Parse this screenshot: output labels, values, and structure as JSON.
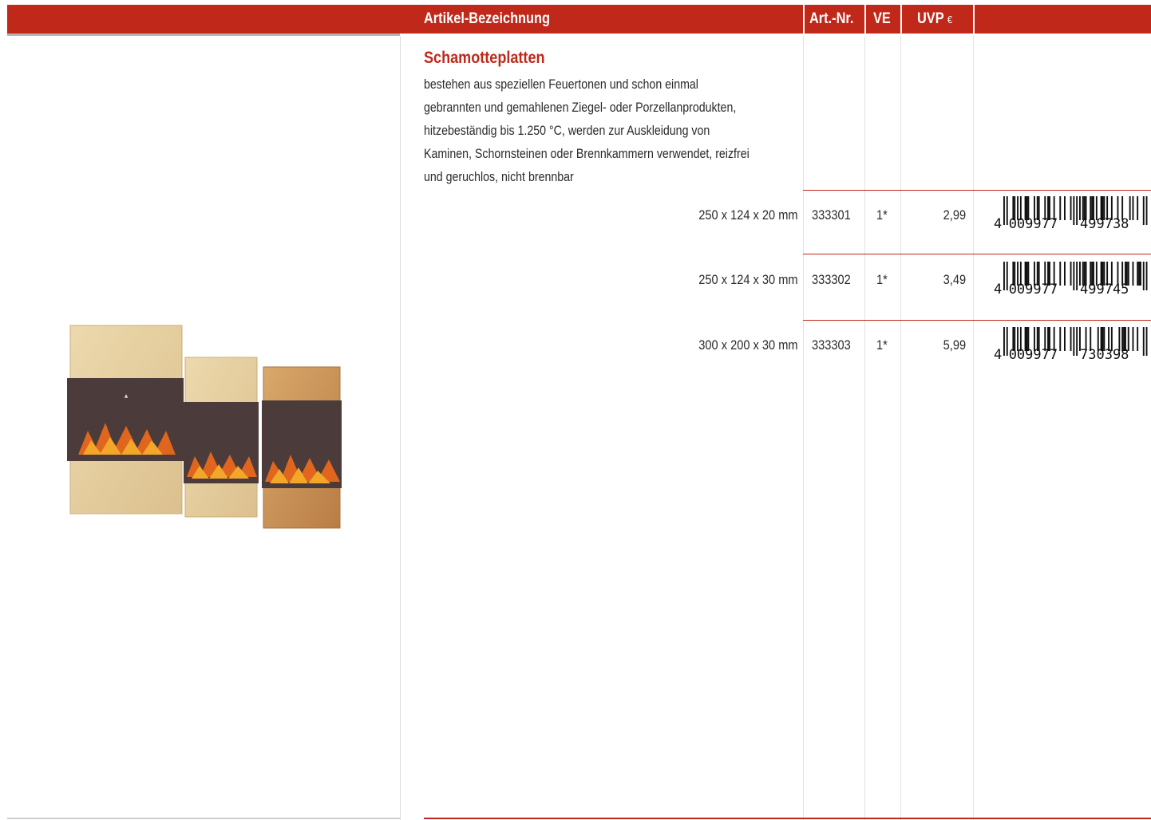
{
  "header": {
    "col_designation": "Artikel-Bezeichnung",
    "col_art_nr": "Art.-Nr.",
    "col_ve": "VE",
    "col_uvp": "UVP",
    "col_uvp_unit": "€"
  },
  "product": {
    "title": "Schamotteplatten",
    "description_lines": [
      "bestehen aus speziellen Feuertonen und schon einmal",
      "gebrannten und gemahlenen Ziegel- oder Porzellanprodukten,",
      "hitzebeständig bis 1.250 °C, werden zur Auskleidung von",
      "Kaminen, Schornsteinen oder Brennkammern verwendet, reizfrei",
      "und geruchlos, nicht brennbar"
    ]
  },
  "rows": [
    {
      "dimensions": "250 x 124 x 20 mm",
      "art_nr": "333301",
      "ve": "1*",
      "price": "2,99",
      "ean": "4009977499738"
    },
    {
      "dimensions": "250 x 124 x 30 mm",
      "art_nr": "333302",
      "ve": "1*",
      "price": "3,49",
      "ean": "4009977499745"
    },
    {
      "dimensions": "300 x 200 x 30 mm",
      "art_nr": "333303",
      "ve": "1*",
      "price": "5,99",
      "ean": "4009977730398"
    }
  ],
  "colors": {
    "accent_red": "#c0281a",
    "brick_light": "#e6cf9f",
    "brick_dark": "#c9945b",
    "label_band": "#4a3a3a"
  }
}
